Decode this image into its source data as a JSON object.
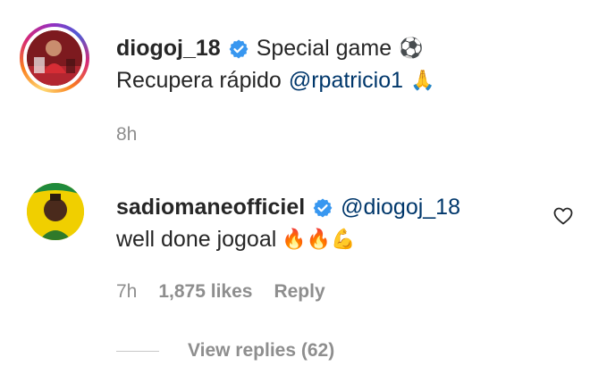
{
  "post": {
    "username": "diogoj_18",
    "caption_line1": "Special game",
    "caption_line1_emoji": "⚽",
    "caption_line2_text": "Recupera rápido",
    "caption_mention": "@rpatricio1",
    "caption_line2_emoji": "🙏",
    "time": "8h"
  },
  "comment": {
    "username": "sadiomaneofficiel",
    "mention": "@diogoj_18",
    "text": "well done jogoal",
    "emojis": "🔥🔥💪",
    "time": "7h",
    "likes": "1,875 likes",
    "reply_label": "Reply",
    "view_replies": "View replies (62)"
  },
  "colors": {
    "verified": "#3897f0",
    "mention": "#00376b",
    "meta": "#8e8e8e",
    "text": "#262626"
  },
  "icons": {
    "verified": "verified-badge-icon",
    "heart": "heart-outline-icon"
  }
}
